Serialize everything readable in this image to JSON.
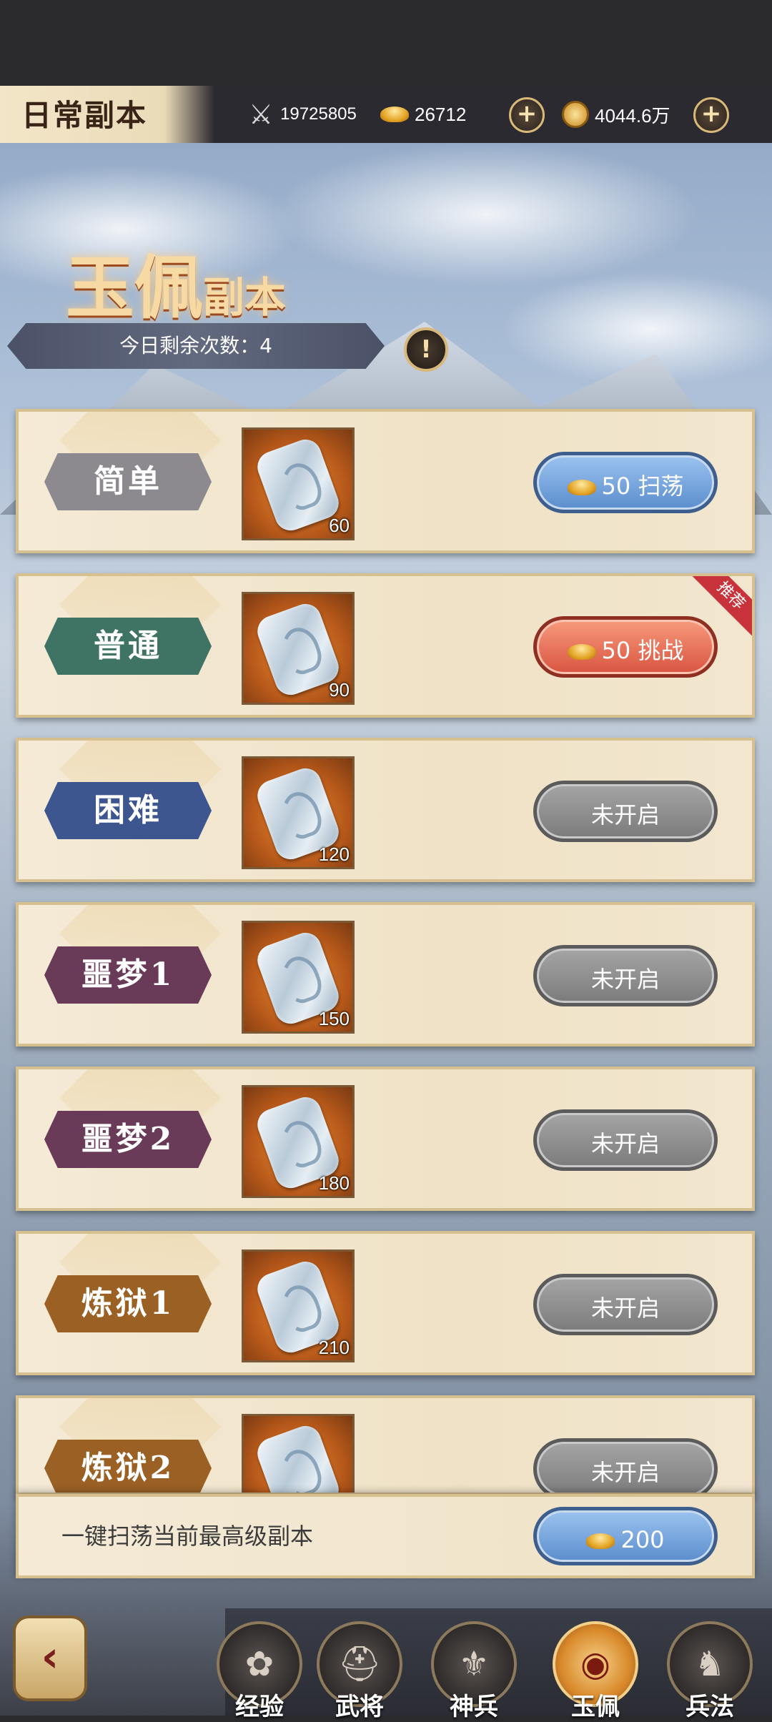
{
  "topbar": {
    "title": "日常副本",
    "power": "19725805",
    "gold_ingots": "26712",
    "coins": "4044.6万"
  },
  "header": {
    "title_big": "玉佩",
    "title_small": "副本",
    "remaining_label": "今日剩余次数：4"
  },
  "rows": [
    {
      "label": "简单",
      "item_count": "60",
      "action": "50 扫荡",
      "state": "sweep"
    },
    {
      "label": "普通",
      "item_count": "90",
      "action": "50 挑战",
      "state": "challenge",
      "tag": "推荐"
    },
    {
      "label": "困难",
      "item_count": "120",
      "action": "未开启",
      "state": "locked"
    },
    {
      "label": "噩梦1",
      "item_count": "150",
      "action": "未开启",
      "state": "locked"
    },
    {
      "label": "噩梦2",
      "item_count": "180",
      "action": "未开启",
      "state": "locked"
    },
    {
      "label": "炼狱1",
      "item_count": "210",
      "action": "未开启",
      "state": "locked"
    },
    {
      "label": "炼狱2",
      "item_count": "",
      "action": "未开启",
      "state": "locked"
    }
  ],
  "sweep_all": {
    "label": "一键扫荡当前最高级副本",
    "cost": "200"
  },
  "nav": {
    "tabs": [
      {
        "label": "经验",
        "icon": "exp-icon"
      },
      {
        "label": "武将",
        "icon": "general-icon"
      },
      {
        "label": "神兵",
        "icon": "weapon-icon"
      },
      {
        "label": "玉佩",
        "icon": "jade-icon",
        "active": true
      },
      {
        "label": "兵法",
        "icon": "strategy-icon"
      }
    ]
  },
  "colors": {
    "easy_plate": "#8c8a8e",
    "normal_plate": "#3f7363",
    "hard_plate": "#3d5690",
    "nightmare_plate": "#6a3b59",
    "purgatory_plate": "#9a6024"
  }
}
